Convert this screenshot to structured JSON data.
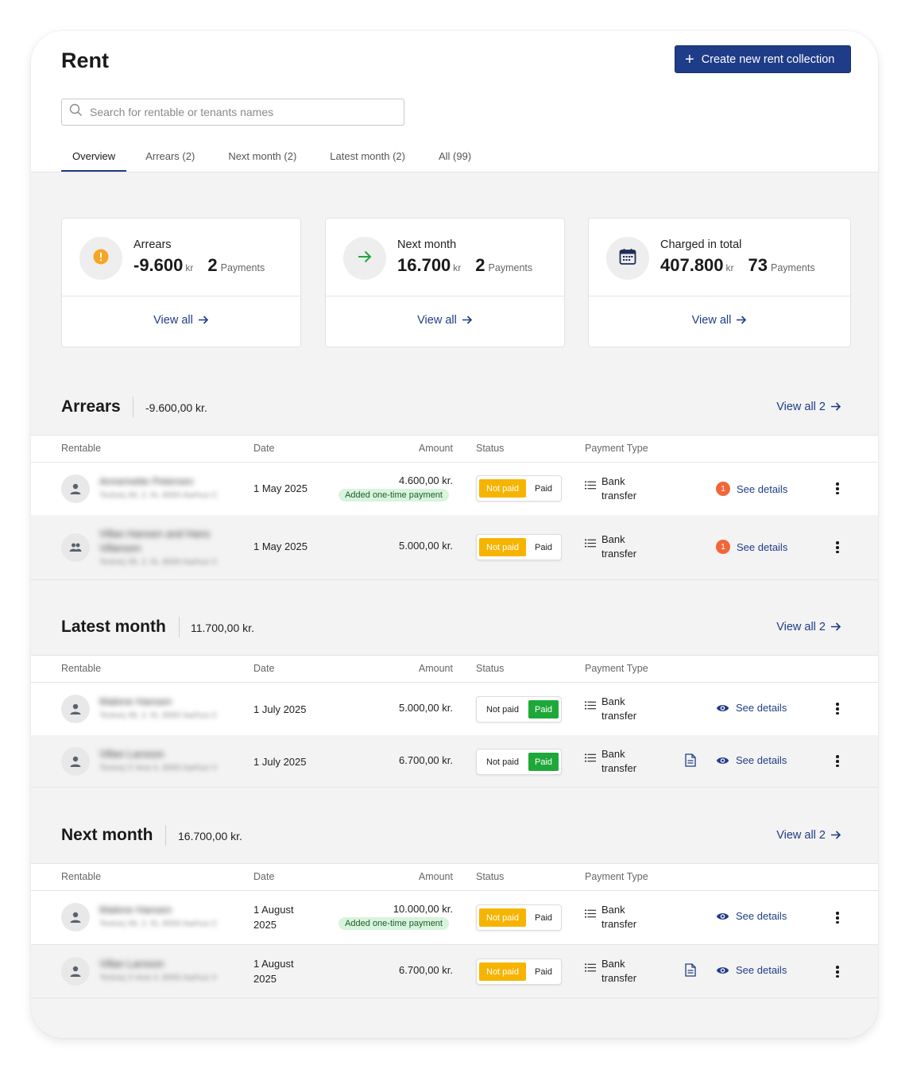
{
  "page": {
    "title": "Rent",
    "create_button": "Create new rent collection"
  },
  "search": {
    "placeholder": "Search for rentable or tenants names"
  },
  "tabs": [
    "Overview",
    "Arrears (2)",
    "Next month (2)",
    "Latest month (2)",
    "All (99)"
  ],
  "stats": [
    {
      "label": "Arrears",
      "value": "-9.600",
      "unit": "kr",
      "count": "2",
      "count_unit": "Payments",
      "icon": "exclamation-icon",
      "view_all": "View all"
    },
    {
      "label": "Next month",
      "value": "16.700",
      "unit": "kr",
      "count": "2",
      "count_unit": "Payments",
      "icon": "arrow-right-icon",
      "view_all": "View all"
    },
    {
      "label": "Charged in total",
      "value": "407.800",
      "unit": "kr",
      "count": "73",
      "count_unit": "Payments",
      "icon": "calendar-icon",
      "view_all": "View all"
    }
  ],
  "columns": {
    "rentable": "Rentable",
    "date": "Date",
    "amount": "Amount",
    "status": "Status",
    "payment_type": "Payment Type"
  },
  "status_labels": {
    "not_paid": "Not paid",
    "paid": "Paid"
  },
  "sections": [
    {
      "title": "Arrears",
      "total": "-9.600,00 kr.",
      "view_all": "View all 2",
      "rows": [
        {
          "name": "Annemette Petersen",
          "address": "Testvej 49, 2. th, 8000 Aarhus C",
          "avatar": "person-icon",
          "date": "1 May 2025",
          "amount": "4.600,00 kr.",
          "note": "Added one-time payment",
          "status": "not_paid",
          "payment_type": [
            "Bank",
            "transfer"
          ],
          "alert": "1",
          "details": "See details"
        },
        {
          "name": "Villan Hansen and Hans",
          "name2": "Villansen",
          "address": "Testvej 49, 2. th, 8000 Aarhus C",
          "avatar": "people-icon",
          "date": "1 May 2025",
          "amount": "5.000,00 kr.",
          "note": "",
          "status": "not_paid",
          "payment_type": [
            "Bank",
            "transfer"
          ],
          "alert": "1",
          "details": "See details"
        }
      ]
    },
    {
      "title": "Latest month",
      "total": "11.700,00 kr.",
      "view_all": "View all 2",
      "rows": [
        {
          "name": "Malene Hansen",
          "address": "Testvej 49, 2. th, 8000 Aarhus C",
          "avatar": "person-icon",
          "date": "1 July 2025",
          "amount": "5.000,00 kr.",
          "note": "",
          "status": "paid",
          "payment_type": [
            "Bank",
            "transfer"
          ],
          "details": "See details"
        },
        {
          "name": "Villan Larsson",
          "address": "Testvej 3 Vest 4, 8000 Aarhus V",
          "avatar": "person-icon",
          "date": "1 July 2025",
          "amount": "6.700,00 kr.",
          "note": "",
          "status": "paid",
          "payment_type": [
            "Bank",
            "transfer"
          ],
          "details": "See details",
          "doc": true
        }
      ]
    },
    {
      "title": "Next month",
      "total": "16.700,00 kr.",
      "view_all": "View all 2",
      "rows": [
        {
          "name": "Malene Hansen",
          "address": "Testvej 49, 2. th, 8000 Aarhus C",
          "avatar": "person-icon",
          "date": [
            "1 August",
            "2025"
          ],
          "amount": "10.000,00 kr.",
          "note": "Added one-time payment",
          "status": "not_paid",
          "payment_type": [
            "Bank",
            "transfer"
          ],
          "details": "See details"
        },
        {
          "name": "Villan Larsson",
          "address": "Testvej 3 Vest 4, 8000 Aarhus V",
          "avatar": "person-icon",
          "date": [
            "1 August",
            "2025"
          ],
          "amount": "6.700,00 kr.",
          "note": "",
          "status": "not_paid",
          "payment_type": [
            "Bank",
            "transfer"
          ],
          "details": "See details",
          "doc": true
        }
      ]
    }
  ],
  "colors": {
    "primary": "#1f3c88",
    "not_paid": "#f6b400",
    "paid": "#1fa83a",
    "alert": "#f2663a",
    "warning_icon": "#f6a623",
    "success_arrow": "#1fa83a"
  }
}
